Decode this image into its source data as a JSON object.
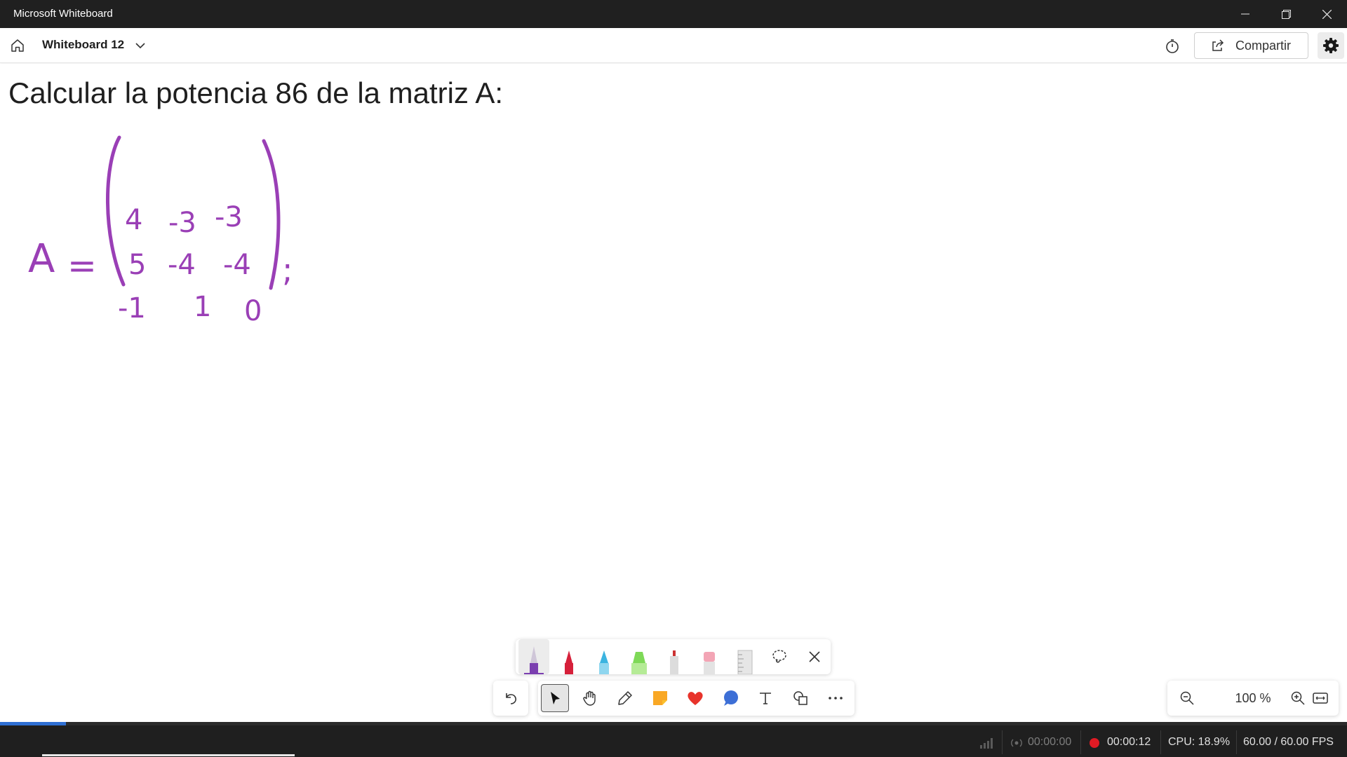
{
  "window": {
    "title": "Microsoft Whiteboard",
    "controls": [
      "minimize-icon",
      "restore-icon",
      "close-icon"
    ]
  },
  "header": {
    "board_name": "Whiteboard 12",
    "share_label": "Compartir"
  },
  "canvas": {
    "heading": "Calcular la potencia 86 de la matriz A:",
    "ink_color": "#9a3fb6",
    "ink": {
      "lhs": "A",
      "equals": "=",
      "matrix": [
        [
          "4",
          "-3",
          "-3"
        ],
        [
          "5",
          "-4",
          "-4"
        ],
        [
          "-1",
          "1",
          "0"
        ]
      ],
      "terminator": ";"
    }
  },
  "ink_tray": {
    "tools": [
      "pen-purple-icon",
      "pen-red-icon",
      "pen-blue-icon",
      "highlighter-green-icon",
      "pen-silver-icon",
      "eraser-icon",
      "ruler-icon",
      "lasso-icon",
      "close-icon"
    ],
    "colors": {
      "purple": "#7b3fb0",
      "red": "#d6203a",
      "blue": "#3cb4e0",
      "green": "#7ed957",
      "silver": "#d9d9d9",
      "eraser": "#f3a5b5"
    }
  },
  "toolbar": {
    "tools": [
      "undo-icon",
      "select-icon",
      "pan-hand-icon",
      "inking-icon",
      "sticky-note-icon",
      "reactions-icon",
      "comment-icon",
      "text-icon",
      "shapes-icon",
      "more-icon"
    ]
  },
  "zoom": {
    "value": "100 %"
  },
  "recorder": {
    "live_time": "00:00:00",
    "rec_time": "00:00:12",
    "cpu": "CPU: 18.9%",
    "fps": "60.00 / 60.00 FPS"
  }
}
